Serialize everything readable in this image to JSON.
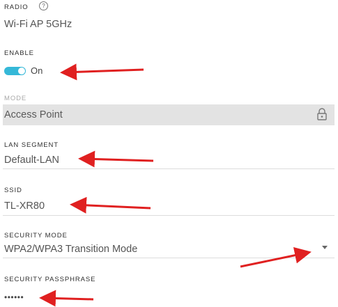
{
  "radio": {
    "label": "RADIO",
    "help_icon": "help-circle-icon",
    "help_glyph": "?",
    "value": "Wi-Fi AP 5GHz"
  },
  "enable": {
    "label": "ENABLE",
    "toggle_state": "On",
    "toggle_on": true
  },
  "mode": {
    "label": "MODE",
    "value": "Access Point",
    "lock_icon": "lock-icon",
    "disabled": true
  },
  "lan_segment": {
    "label": "LAN SEGMENT",
    "value": "Default-LAN"
  },
  "ssid": {
    "label": "SSID",
    "value": "TL-XR80"
  },
  "security_mode": {
    "label": "SECURITY MODE",
    "value": "WPA2/WPA3 Transition Mode",
    "dropdown_icon": "chevron-down-icon"
  },
  "security_passphrase": {
    "label": "SECURITY PASSPHRASE",
    "value": "••••••"
  },
  "colors": {
    "accent": "#35b8d8",
    "annotation": "#e02020",
    "disabled_bg": "#e3e3e3"
  }
}
